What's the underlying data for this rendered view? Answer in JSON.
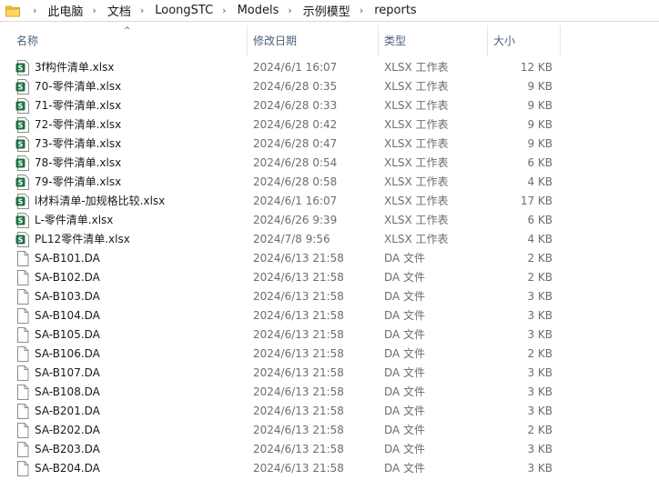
{
  "breadcrumb": [
    "此电脑",
    "文档",
    "LoongSTC",
    "Models",
    "示例模型",
    "reports"
  ],
  "columns": {
    "name": "名称",
    "date": "修改日期",
    "type": "类型",
    "size": "大小"
  },
  "files": [
    {
      "icon": "excel-file-icon",
      "name": "3f构件清单.xlsx",
      "date": "2024/6/1 16:07",
      "type": "XLSX 工作表",
      "size": "12 KB"
    },
    {
      "icon": "excel-file-icon",
      "name": "70-零件清单.xlsx",
      "date": "2024/6/28 0:35",
      "type": "XLSX 工作表",
      "size": "9 KB"
    },
    {
      "icon": "excel-file-icon",
      "name": "71-零件清单.xlsx",
      "date": "2024/6/28 0:33",
      "type": "XLSX 工作表",
      "size": "9 KB"
    },
    {
      "icon": "excel-file-icon",
      "name": "72-零件清单.xlsx",
      "date": "2024/6/28 0:42",
      "type": "XLSX 工作表",
      "size": "9 KB"
    },
    {
      "icon": "excel-file-icon",
      "name": "73-零件清单.xlsx",
      "date": "2024/6/28 0:47",
      "type": "XLSX 工作表",
      "size": "9 KB"
    },
    {
      "icon": "excel-file-icon",
      "name": "78-零件清单.xlsx",
      "date": "2024/6/28 0:54",
      "type": "XLSX 工作表",
      "size": "6 KB"
    },
    {
      "icon": "excel-file-icon",
      "name": "79-零件清单.xlsx",
      "date": "2024/6/28 0:58",
      "type": "XLSX 工作表",
      "size": "4 KB"
    },
    {
      "icon": "excel-file-icon",
      "name": "l材料清单-加规格比较.xlsx",
      "date": "2024/6/1 16:07",
      "type": "XLSX 工作表",
      "size": "17 KB"
    },
    {
      "icon": "excel-file-icon",
      "name": "L-零件清单.xlsx",
      "date": "2024/6/26 9:39",
      "type": "XLSX 工作表",
      "size": "6 KB"
    },
    {
      "icon": "excel-file-icon",
      "name": "PL12零件清单.xlsx",
      "date": "2024/7/8 9:56",
      "type": "XLSX 工作表",
      "size": "4 KB"
    },
    {
      "icon": "blank-file-icon",
      "name": "SA-B101.DA",
      "date": "2024/6/13 21:58",
      "type": "DA 文件",
      "size": "2 KB"
    },
    {
      "icon": "blank-file-icon",
      "name": "SA-B102.DA",
      "date": "2024/6/13 21:58",
      "type": "DA 文件",
      "size": "2 KB"
    },
    {
      "icon": "blank-file-icon",
      "name": "SA-B103.DA",
      "date": "2024/6/13 21:58",
      "type": "DA 文件",
      "size": "3 KB"
    },
    {
      "icon": "blank-file-icon",
      "name": "SA-B104.DA",
      "date": "2024/6/13 21:58",
      "type": "DA 文件",
      "size": "3 KB"
    },
    {
      "icon": "blank-file-icon",
      "name": "SA-B105.DA",
      "date": "2024/6/13 21:58",
      "type": "DA 文件",
      "size": "3 KB"
    },
    {
      "icon": "blank-file-icon",
      "name": "SA-B106.DA",
      "date": "2024/6/13 21:58",
      "type": "DA 文件",
      "size": "2 KB"
    },
    {
      "icon": "blank-file-icon",
      "name": "SA-B107.DA",
      "date": "2024/6/13 21:58",
      "type": "DA 文件",
      "size": "3 KB"
    },
    {
      "icon": "blank-file-icon",
      "name": "SA-B108.DA",
      "date": "2024/6/13 21:58",
      "type": "DA 文件",
      "size": "3 KB"
    },
    {
      "icon": "blank-file-icon",
      "name": "SA-B201.DA",
      "date": "2024/6/13 21:58",
      "type": "DA 文件",
      "size": "3 KB"
    },
    {
      "icon": "blank-file-icon",
      "name": "SA-B202.DA",
      "date": "2024/6/13 21:58",
      "type": "DA 文件",
      "size": "2 KB"
    },
    {
      "icon": "blank-file-icon",
      "name": "SA-B203.DA",
      "date": "2024/6/13 21:58",
      "type": "DA 文件",
      "size": "3 KB"
    },
    {
      "icon": "blank-file-icon",
      "name": "SA-B204.DA",
      "date": "2024/6/13 21:58",
      "type": "DA 文件",
      "size": "3 KB"
    }
  ],
  "colors": {
    "header_text": "#4c607a",
    "excel_green": "#1e7145",
    "secondary_text": "#6d6d6d"
  }
}
